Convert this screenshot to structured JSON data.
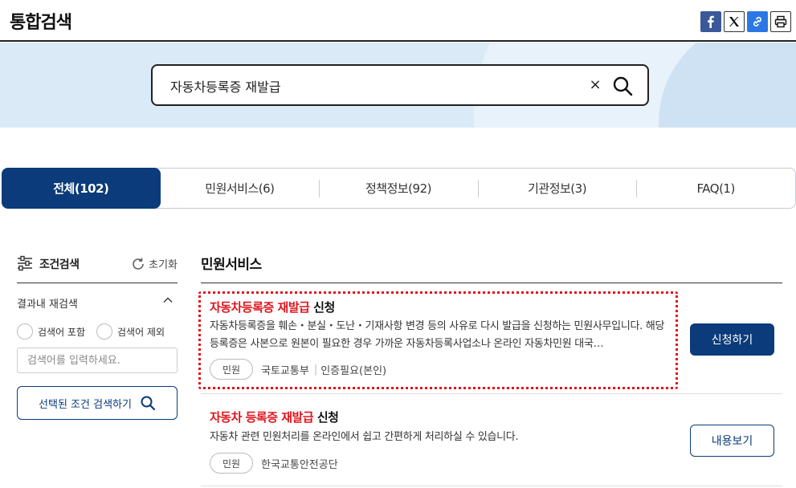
{
  "header": {
    "title": "통합검색",
    "share": [
      {
        "icon": "facebook-icon"
      },
      {
        "icon": "x-twitter-icon"
      },
      {
        "icon": "link-icon"
      },
      {
        "icon": "print-icon"
      }
    ]
  },
  "search": {
    "value": "자동차등록증 재발급",
    "clear_label": "×"
  },
  "tabs": [
    {
      "label": "전체(102)",
      "active": true
    },
    {
      "label": "민원서비스(6)",
      "active": false
    },
    {
      "label": "정책정보(92)",
      "active": false
    },
    {
      "label": "기관정보(3)",
      "active": false
    },
    {
      "label": "FAQ(1)",
      "active": false
    }
  ],
  "filter": {
    "title": "조건검색",
    "reset_label": "초기화",
    "section_label": "결과내 재검색",
    "options": [
      "검색어 포함",
      "검색어 제외"
    ],
    "input_placeholder": "검색어를 입력하세요.",
    "apply_label": "선택된 조건 검색하기"
  },
  "results": {
    "section_title": "민원서비스",
    "items": [
      {
        "title_highlight": "자동차등록증 재발급",
        "title_rest": " 신청",
        "description": "자동차등록증을 훼손・분실・도난・기재사항 변경 등의 사유로 다시 발급을 신청하는 민원사무입니다. 해당 등록증은 사본으로 원본이 필요한 경우 가까운 자동차등록사업소나 온라인 자동차민원 대국…",
        "badge": "민원",
        "agency": "국토교통부",
        "auth": "인증필요(본인)",
        "button": "신청하기"
      },
      {
        "title_highlight": "자동차 등록증 재발급",
        "title_rest": " 신청",
        "description": "자동차 관련 민원처리를 온라인에서 쉽고 간편하게 처리하실 수 있습니다.",
        "badge": "민원",
        "agency": "한국교통안전공단",
        "button": "내용보기"
      }
    ]
  },
  "colors": {
    "primary": "#0b3b7a",
    "highlight": "#e0141c",
    "banner": "#dbeaf7"
  }
}
